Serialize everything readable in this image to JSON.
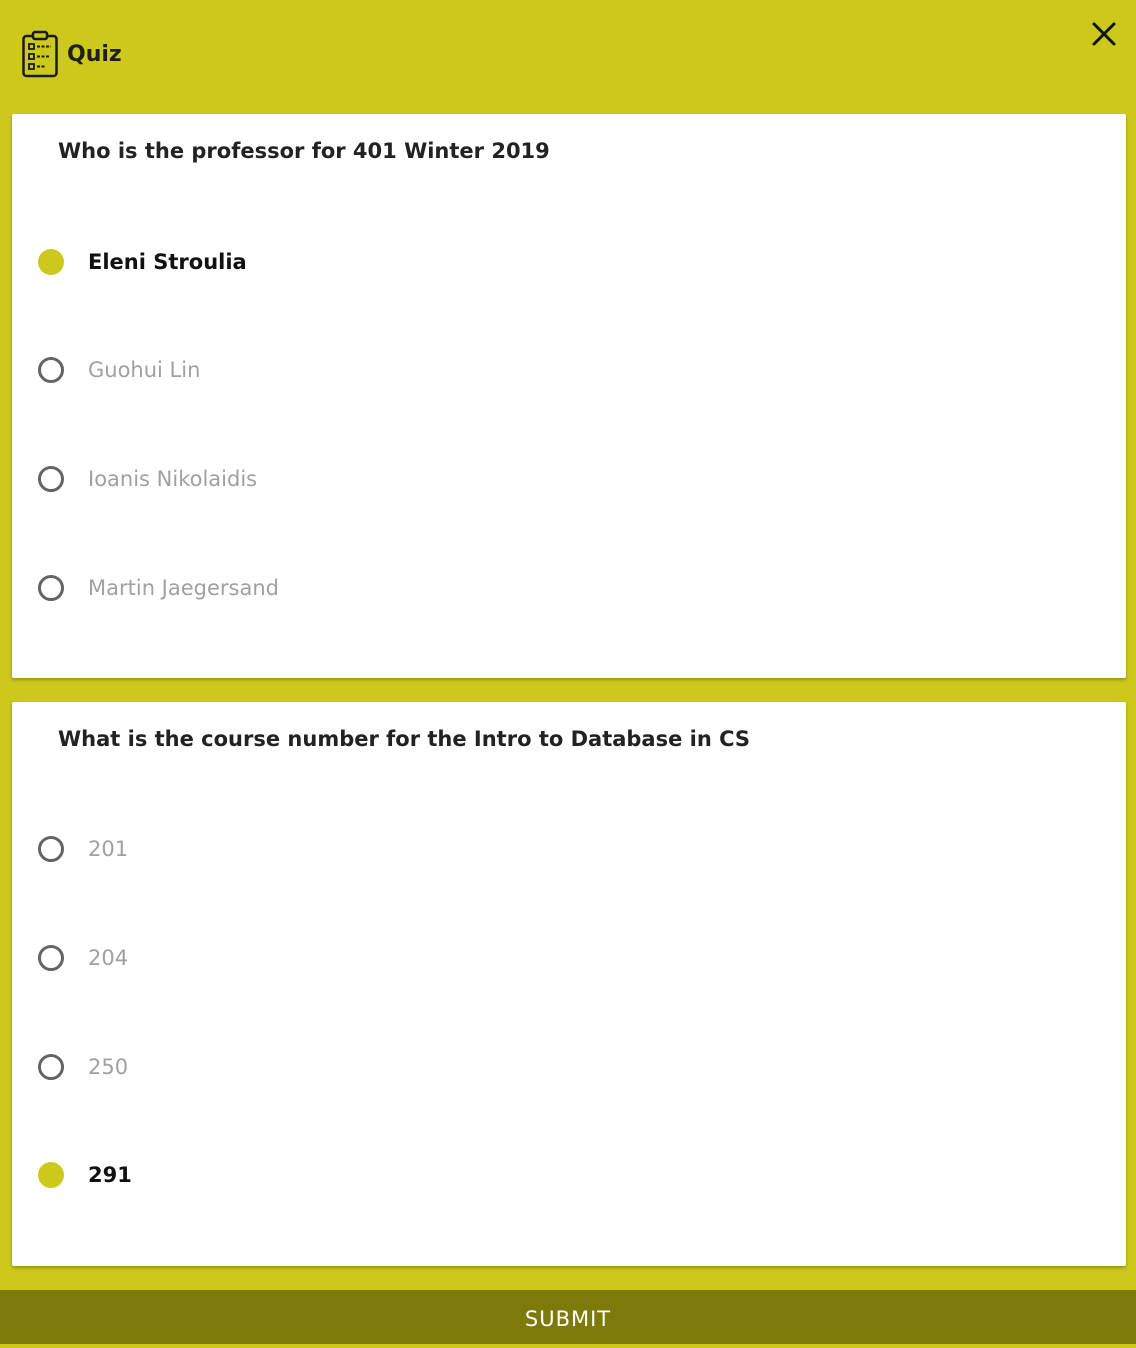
{
  "header": {
    "title": "Quiz",
    "icon": "clipboard-list-icon",
    "close_icon": "close-icon"
  },
  "colors": {
    "background": "#cdc81c",
    "accent": "#cdc81c",
    "submit_bar": "#7d7a0a",
    "card": "#ffffff"
  },
  "questions": [
    {
      "text": "Who is the professor for 401 Winter 2019",
      "options": [
        {
          "label": "Eleni Stroulia",
          "selected": true
        },
        {
          "label": "Guohui Lin",
          "selected": false
        },
        {
          "label": "Ioanis Nikolaidis",
          "selected": false
        },
        {
          "label": "Martin Jaegersand",
          "selected": false
        }
      ]
    },
    {
      "text": "What is the course number for the Intro to Database in CS",
      "options": [
        {
          "label": "201",
          "selected": false
        },
        {
          "label": "204",
          "selected": false
        },
        {
          "label": "250",
          "selected": false
        },
        {
          "label": "291",
          "selected": true
        }
      ]
    }
  ],
  "submit_label": "SUBMIT"
}
